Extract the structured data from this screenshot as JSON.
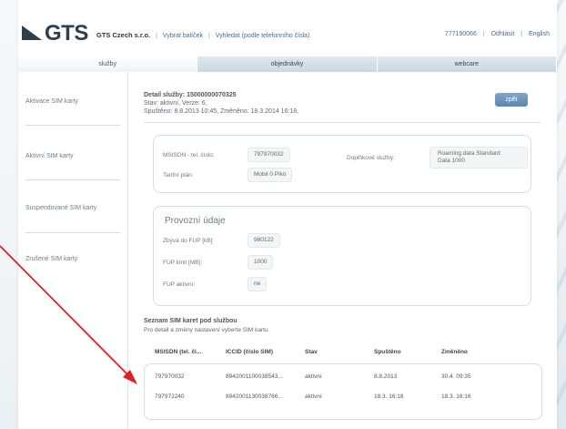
{
  "brand": {
    "logo_text": "GTS"
  },
  "top_nav": {
    "company": "GTS Czech s.r.o.",
    "items": [
      "Vybrat balíček",
      "Vyhledat (podle telefonního čísla)"
    ]
  },
  "top_right": {
    "phone": "777190066",
    "logout": "Odhlásit",
    "language": "English"
  },
  "tabs": [
    {
      "label": "služby",
      "active": true
    },
    {
      "label": "objednávky",
      "active": false
    },
    {
      "label": "webcare",
      "active": false
    }
  ],
  "sidebar": {
    "items": [
      {
        "label": "Aktivace SIM karty"
      },
      {
        "label": "Aktivní SIM karty"
      },
      {
        "label": "Suspendované SIM karty"
      },
      {
        "label": "Zrušené SIM karty"
      }
    ]
  },
  "detail": {
    "title": "Detail služby: 15000000070325",
    "status_line": "Stav: aktivní,   Verze: 6,",
    "dates_line": "Spuštěno: 8.8.2013 10:45,   Změněno: 18.3.2014 16:18,",
    "back_label": "zpět"
  },
  "service_box": {
    "msisdn_label": "MSISDN - tel. číslo:",
    "msisdn_value": "797970032",
    "tariff_label": "Tarifní plán:",
    "tariff_value": "Mobil 0 Piko",
    "extra_label": "Doplňkové služby:",
    "extra_value_1": "Roaming data Standard",
    "extra_value_2": "Data 1000"
  },
  "operations": {
    "title": "Provozní údaje",
    "fup_left_label": "Zbývá do FUP [kB]:",
    "fup_left_value": "980122",
    "fup_limit_label": "FUP limit [MB]:",
    "fup_limit_value": "1000",
    "fup_active_label": "FUP aktivní:",
    "fup_active_value": "ne"
  },
  "sim_list": {
    "title": "Seznam SIM karet pod službou",
    "subtitle": "Pro detail a změny nastavení vyberte SIM kartu",
    "headers": [
      "MSISDN (tel. či...",
      "ICCID (číslo SIM)",
      "Stav",
      "Spuštěno",
      "Změněno"
    ],
    "rows": [
      [
        "797970032",
        "8942001100038543...",
        "aktivní",
        "8.8.2013",
        "30.4. 09:35"
      ],
      [
        "797972240",
        "8942001130038766...",
        "aktivní",
        "18.3. 16:18",
        "18.3. 16:16"
      ]
    ]
  },
  "colors": {
    "accent": "#5e86ab",
    "arrow": "#e02020",
    "tab_bg": "#c9d8e3"
  }
}
